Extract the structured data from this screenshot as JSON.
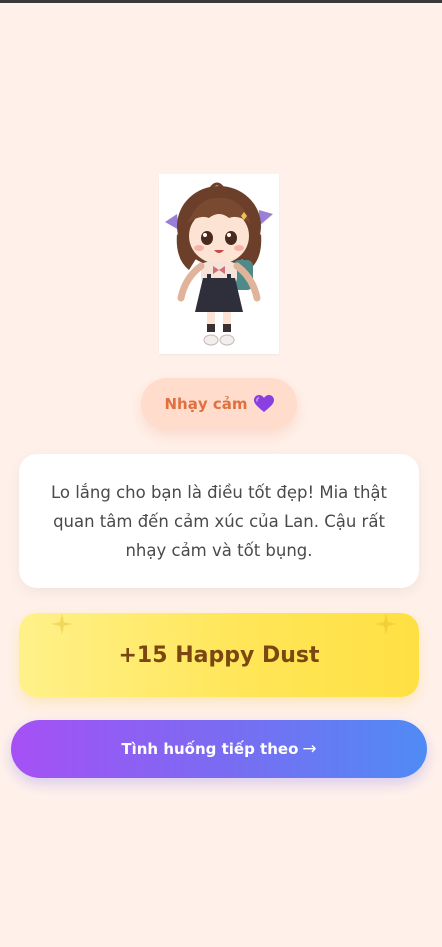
{
  "character": {
    "image": "chibi-girl-backpack"
  },
  "trait": {
    "label": "Nhạy cảm",
    "icon": "purple-heart-icon",
    "color": "#e0703f"
  },
  "message": {
    "text": "Lo lắng cho bạn là điều tốt đẹp! Mia thật quan tâm đến cảm xúc của Lan. Cậu rất nhạy cảm và tốt bụng."
  },
  "reward": {
    "label": "+15 Happy Dust"
  },
  "next_button": {
    "label": "Tình huống tiếp theo",
    "arrow": "→"
  },
  "colors": {
    "background": "#fff1ea",
    "pill": "#ffdccc",
    "reward_gradient": [
      "#fff18a",
      "#ffe043"
    ],
    "button_gradient": [
      "#a650f5",
      "#4f8bf5"
    ]
  }
}
